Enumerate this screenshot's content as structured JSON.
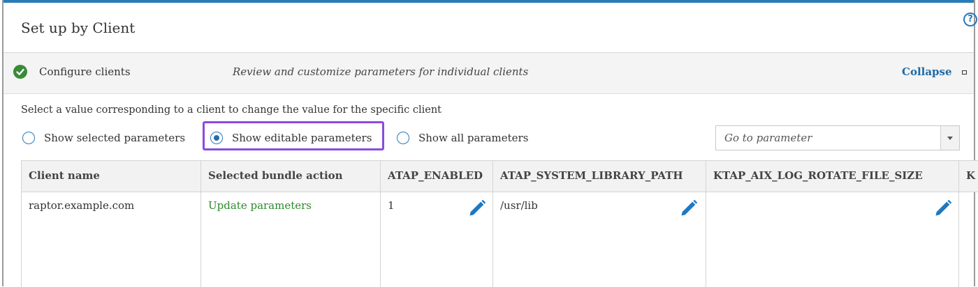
{
  "panel": {
    "title": "Set up by Client",
    "help_glyph": "?"
  },
  "step": {
    "name": "Configure clients",
    "description": "Review and customize parameters for individual clients",
    "collapse_label": "Collapse",
    "status": "complete"
  },
  "instruction": "Select a value corresponding to a client to change the value for the specific client",
  "filters": [
    {
      "label": "Show selected parameters",
      "selected": false
    },
    {
      "label": "Show editable parameters",
      "selected": true
    },
    {
      "label": "Show all parameters",
      "selected": false
    }
  ],
  "goto": {
    "placeholder": "Go to parameter"
  },
  "table": {
    "columns": [
      "Client name",
      "Selected bundle action",
      "ATAP_ENABLED",
      "ATAP_SYSTEM_LIBRARY_PATH",
      "KTAP_AIX_LOG_ROTATE_FILE_SIZE",
      "K"
    ],
    "rows": [
      {
        "client": "raptor.example.com",
        "action": "Update parameters",
        "atap_enabled": "1",
        "atap_system_library_path": "/usr/lib",
        "ktap_aix_log_rotate_file_size": ""
      }
    ]
  },
  "colors": {
    "accent": "#2b7bb9",
    "link": "#1c6aa6",
    "success": "#3a8a3a",
    "action_text": "#2c8a2c",
    "highlight": "#8a4ae0",
    "edit_icon": "#1e78c2"
  },
  "icons": {
    "status": "check-circle-icon",
    "help": "help-circle-icon",
    "collapse": "collapse-square-icon",
    "edit": "pencil-icon",
    "dropdown": "caret-down-icon"
  }
}
